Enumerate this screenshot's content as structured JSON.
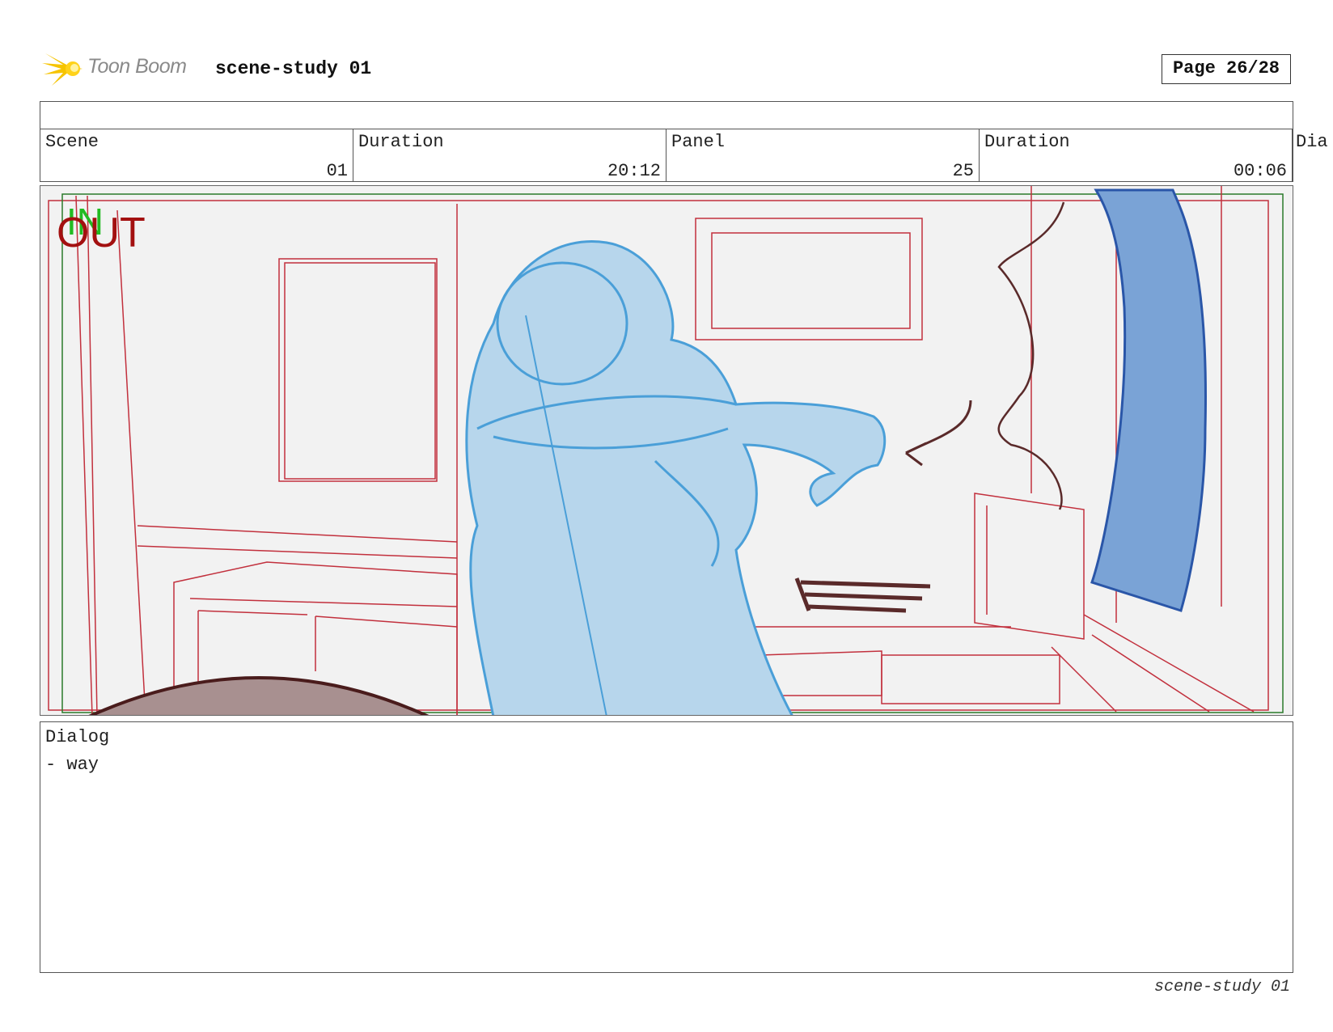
{
  "header": {
    "logo_text": "Toon Boom",
    "title": "scene-study 01",
    "page_label": "Page 26/28"
  },
  "info": {
    "cells": [
      {
        "label": "Scene",
        "value": "01"
      },
      {
        "label": "Duration",
        "value": "20:12"
      },
      {
        "label": "Panel",
        "value": "25"
      },
      {
        "label": "Duration",
        "value": "00:06"
      }
    ],
    "overflow_label": "Dia"
  },
  "panel": {
    "in_marker": "IN",
    "out_marker": "OUT",
    "colors": {
      "background": "#f2f2f2",
      "safe_frame": "#c2303d",
      "camera_frame": "#2a7a2a",
      "character": "#8ec3e6",
      "character_outline": "#4a9fd8",
      "prop_dark": "#5a2a2a",
      "curtain": "#7aa3d6",
      "table_top": "#a89090",
      "in_color": "#22bb22",
      "out_color": "#a31010"
    }
  },
  "dialog": {
    "label": "Dialog",
    "text": "- way"
  },
  "footer": {
    "text": "scene-study 01"
  }
}
